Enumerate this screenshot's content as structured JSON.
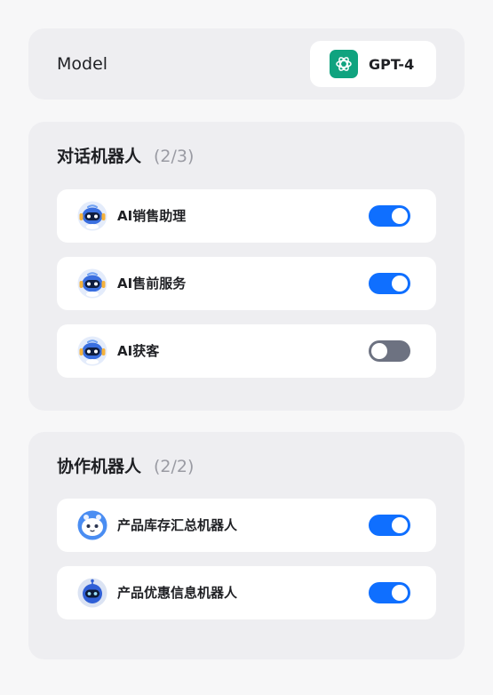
{
  "model": {
    "label": "Model",
    "selected": "GPT-4",
    "icon": "openai-logo-icon",
    "icon_bg": "#10a37f"
  },
  "chat_bots": {
    "title": "对话机器人",
    "count": "(2/3)",
    "items": [
      {
        "label": "AI销售助理",
        "enabled": true
      },
      {
        "label": "AI售前服务",
        "enabled": true
      },
      {
        "label": "AI获客",
        "enabled": false
      }
    ]
  },
  "collab_bots": {
    "title": "协作机器人",
    "count": "(2/2)",
    "items": [
      {
        "label": "产品库存汇总机器人",
        "enabled": true
      },
      {
        "label": "产品优惠信息机器人",
        "enabled": true
      }
    ]
  },
  "colors": {
    "toggle_on": "#0f6fff",
    "toggle_off": "#6d7281",
    "card_bg": "#eeeef1",
    "row_bg": "#ffffff"
  }
}
